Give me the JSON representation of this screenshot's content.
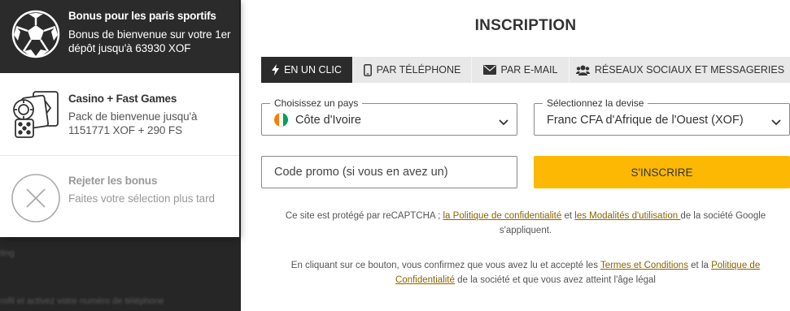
{
  "background": {
    "line1": "ting",
    "line2": "rofil et activez votre numéro de téléphone"
  },
  "bonuses": {
    "sport": {
      "title": "Bonus pour les paris sportifs",
      "description": "Bonus de bienvenue sur votre 1er dépôt jusqu'à 63930 XOF",
      "icon": "soccer-ball-icon"
    },
    "casino": {
      "title": "Casino + Fast Games",
      "description": "Pack de bienvenue jusqu'à 1151771 XOF + 290 FS",
      "icon": "casino-cards-dice-icon"
    },
    "reject": {
      "title": "Rejeter les bonus",
      "description": "Faites votre sélection plus tard",
      "icon": "close-circle-icon"
    }
  },
  "form": {
    "title": "INSCRIPTION",
    "tabs": [
      {
        "label": "EN UN CLIC",
        "icon": "lightning-icon",
        "active": true
      },
      {
        "label": "PAR TÉLÉPHONE",
        "icon": "phone-icon",
        "active": false
      },
      {
        "label": "PAR E-MAIL",
        "icon": "envelope-icon",
        "active": false
      },
      {
        "label": "RÉSEAUX SOCIAUX ET MESSAGERIES",
        "icon": "users-icon",
        "active": false
      }
    ],
    "country": {
      "label": "Choisissez un pays",
      "value": "Côte d'Ivoire",
      "flag_colors": [
        "#f77f00",
        "#ffffff",
        "#009e60"
      ]
    },
    "currency": {
      "label": "Sélectionnez la devise",
      "value": "Franc CFA d'Afrique de l'Ouest (XOF)"
    },
    "promo": {
      "placeholder": "Code promo (si vous en avez un)"
    },
    "submit_label": "S'INSCRIRE",
    "accent_color": "#fcb803"
  },
  "notes": {
    "recaptcha": {
      "before": "Ce site est protégé par reCAPTCHA ; ",
      "link1": "la Politique de confidentialité",
      "between": " et ",
      "link2": "les Modalités d'utilisation ",
      "after": "de la société Google s'appliquent."
    },
    "terms": {
      "before": "En cliquant sur ce bouton, vous confirmez que vous avez lu et accepté les ",
      "link1": "Termes et Conditions",
      "between": " et la ",
      "link2": "Politique de Confidentialité",
      "after": " de la société et que vous avez atteint l'âge légal"
    }
  }
}
